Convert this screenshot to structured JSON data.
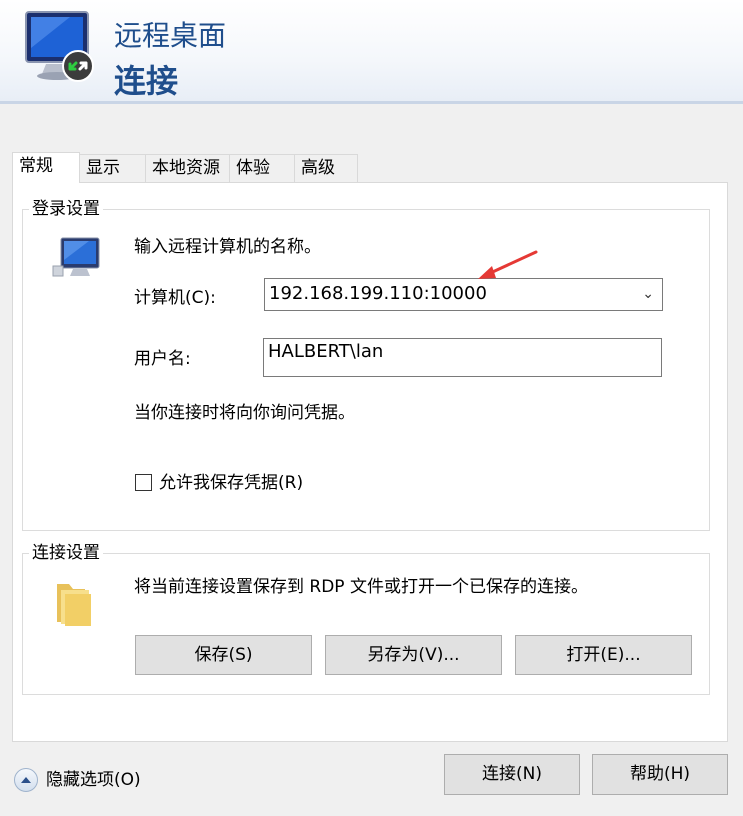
{
  "header": {
    "title_line1": "远程桌面",
    "title_line2": "连接"
  },
  "tabs": [
    {
      "label": "常规"
    },
    {
      "label": "显示"
    },
    {
      "label": "本地资源"
    },
    {
      "label": "体验"
    },
    {
      "label": "高级"
    }
  ],
  "login_settings": {
    "group_title": "登录设置",
    "instruction": "输入远程计算机的名称。",
    "computer_label": "计算机(C):",
    "computer_value": "192.168.199.110:10000",
    "username_label": "用户名:",
    "username_value": "HALBERT\\lan",
    "prompt_note": "当你连接时将向你询问凭据。",
    "save_credentials_label": "允许我保存凭据(R)",
    "save_credentials_checked": false
  },
  "connection_settings": {
    "group_title": "连接设置",
    "description": "将当前连接设置保存到 RDP 文件或打开一个已保存的连接。",
    "save_button": "保存(S)",
    "save_as_button": "另存为(V)...",
    "open_button": "打开(E)..."
  },
  "footer": {
    "hide_options_label": "隐藏选项(O)",
    "connect_button": "连接(N)",
    "help_button": "帮助(H)"
  },
  "colors": {
    "title": "#1f4e8c",
    "annotation_arrow": "#e53935"
  }
}
